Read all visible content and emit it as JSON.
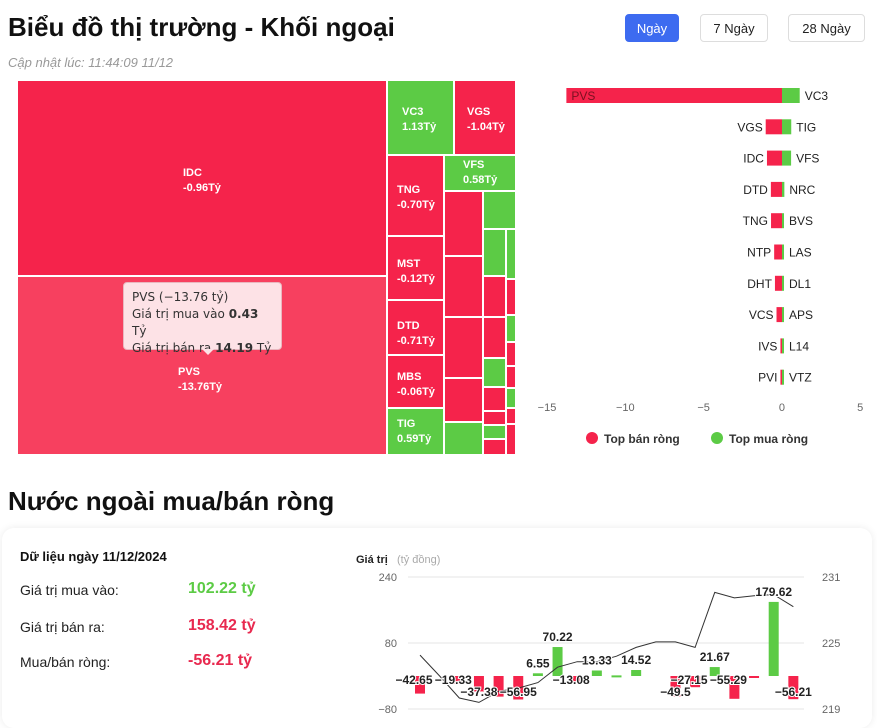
{
  "header": {
    "title": "Biểu đồ thị trường - Khối ngoại",
    "updated": "Cập nhật lúc: 11:44:09 11/12",
    "tabs": [
      {
        "label": "Ngày",
        "active": true
      },
      {
        "label": "7 Ngày",
        "active": false
      },
      {
        "label": "28 Ngày",
        "active": false
      }
    ]
  },
  "colors": {
    "sell": "#f5234b",
    "buy": "#5ccb45",
    "sell_light": "#f7405f",
    "primary": "#3d6bf0"
  },
  "treemap": {
    "cells": [
      {
        "code": "IDC",
        "value": "-0.96Tỷ",
        "side": "sell"
      },
      {
        "code": "PVS",
        "value": "-13.76Tỷ",
        "side": "sell"
      },
      {
        "code": "VC3",
        "value": "1.13Tỷ",
        "side": "buy"
      },
      {
        "code": "VGS",
        "value": "-1.04Tỷ",
        "side": "sell"
      },
      {
        "code": "TNG",
        "value": "-0.70Tỷ",
        "side": "sell"
      },
      {
        "code": "VFS",
        "value": "0.58Tỷ",
        "side": "buy"
      },
      {
        "code": "MST",
        "value": "-0.12Tỷ",
        "side": "sell"
      },
      {
        "code": "DTD",
        "value": "-0.71Tỷ",
        "side": "sell"
      },
      {
        "code": "MBS",
        "value": "-0.06Tỷ",
        "side": "sell"
      },
      {
        "code": "TIG",
        "value": "0.59Tỷ",
        "side": "buy"
      }
    ],
    "tooltip": {
      "title": "PVS (−13.76 tỷ)",
      "buy_label": "Giá trị mua vào",
      "buy_value": "0.43",
      "sell_label": "Giá trị bán ra",
      "sell_value": "14.19",
      "unit": "Tỷ"
    }
  },
  "chart_data": [
    {
      "type": "bar",
      "orientation": "horizontal",
      "xlim": [
        -15,
        5
      ],
      "xticks": [
        "−15",
        "−10",
        "−5",
        "0",
        "5"
      ],
      "legend": "bottom",
      "series": [
        {
          "name": "Top bán ròng",
          "categories": [
            "PVS",
            "VGS",
            "IDC",
            "DTD",
            "TNG",
            "NTP",
            "DHT",
            "VCS",
            "IVS",
            "PVI"
          ],
          "values": [
            -13.76,
            -1.04,
            -0.96,
            -0.71,
            -0.7,
            -0.5,
            -0.45,
            -0.35,
            -0.1,
            -0.1
          ]
        },
        {
          "name": "Top mua ròng",
          "categories": [
            "VC3",
            "TIG",
            "VFS",
            "NRC",
            "BVS",
            "LAS",
            "DL1",
            "APS",
            "L14",
            "VTZ"
          ],
          "values": [
            1.13,
            0.59,
            0.58,
            0.15,
            0.05,
            0.04,
            0.04,
            0.03,
            0.03,
            0.03
          ]
        }
      ]
    },
    {
      "type": "bar+line",
      "ylabel": "Giá trị",
      "yunit": "(tỷ đồng)",
      "ylim": [
        -80,
        240
      ],
      "yticks": [
        "240",
        "80",
        "−80"
      ],
      "y2lim": [
        219,
        231
      ],
      "y2ticks": [
        "231",
        "225",
        "219"
      ],
      "bars": [
        -42.65,
        null,
        -19.33,
        -37.38,
        -50,
        -56.95,
        6.55,
        70.22,
        -13.08,
        13.33,
        1.5,
        14.52,
        null,
        -49.5,
        -27.15,
        21.67,
        -55.29,
        -2,
        179.62,
        -56.21
      ],
      "bar_labels": [
        "−42.65",
        "",
        "−19.33",
        "−37.38",
        "",
        "−56.95",
        "6.55",
        "70.22",
        "−13.08",
        "13.33",
        "",
        "14.52",
        "",
        "−49.5",
        "−27.15",
        "21.67",
        "−55.29",
        "",
        "179.62",
        "−56.21"
      ],
      "line": [
        223.9,
        222.0,
        220.0,
        219.6,
        220.6,
        220.9,
        221.4,
        222.8,
        223.3,
        223.3,
        223.8,
        224.6,
        225.1,
        225.1,
        224.6,
        229.6,
        229.1,
        229.3,
        229.4,
        228.3
      ]
    }
  ],
  "summary": {
    "heading": "Nước ngoài mua/bán ròng",
    "date_label": "Dữ liệu ngày 11/12/2024",
    "rows": [
      {
        "label": "Giá trị mua vào:",
        "value": "102.22 tỷ",
        "color": "#5ccb45"
      },
      {
        "label": "Giá trị bán ra:",
        "value": "158.42 tỷ",
        "color": "#e8294f"
      },
      {
        "label": "Mua/bán ròng:",
        "value": "-56.21 tỷ",
        "color": "#e8294f"
      }
    ]
  }
}
